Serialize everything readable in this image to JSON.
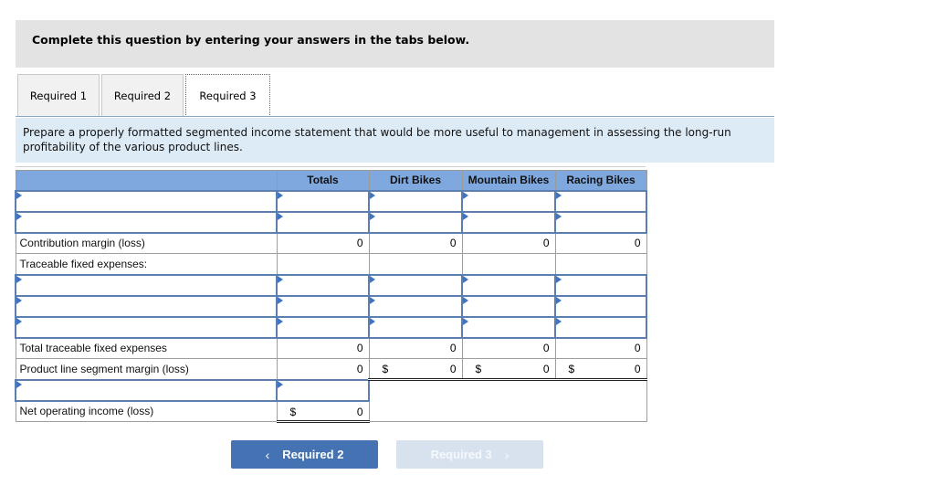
{
  "banner": {
    "text": "Complete this question by entering your answers in the tabs below."
  },
  "tabs": [
    {
      "label": "Required 1",
      "active": false
    },
    {
      "label": "Required 2",
      "active": false
    },
    {
      "label": "Required 3",
      "active": true
    }
  ],
  "instructions": "Prepare a properly formatted segmented income statement that would be more useful to management in assessing the long-run profitability of the various product lines.",
  "table": {
    "columns": [
      "",
      "Totals",
      "Dirt Bikes",
      "Mountain Bikes",
      "Racing Bikes"
    ],
    "rows": {
      "contribution_margin": {
        "label": "Contribution margin (loss)",
        "values": [
          "0",
          "0",
          "0",
          "0"
        ]
      },
      "traceable_fixed_header": {
        "label": "Traceable fixed expenses:"
      },
      "total_traceable_fixed": {
        "label": "Total traceable fixed expenses",
        "values": [
          "0",
          "0",
          "0",
          "0"
        ]
      },
      "segment_margin": {
        "label": "Product line segment margin (loss)",
        "currency": "$",
        "values": [
          "0",
          "0",
          "0",
          "0"
        ]
      },
      "net_operating_income": {
        "label": "Net operating income (loss)",
        "currency": "$",
        "value": "0"
      }
    }
  },
  "nav": {
    "prev_label": "Required 2",
    "next_label": "Required 3",
    "prev_chevron": "‹",
    "next_chevron": "›"
  }
}
